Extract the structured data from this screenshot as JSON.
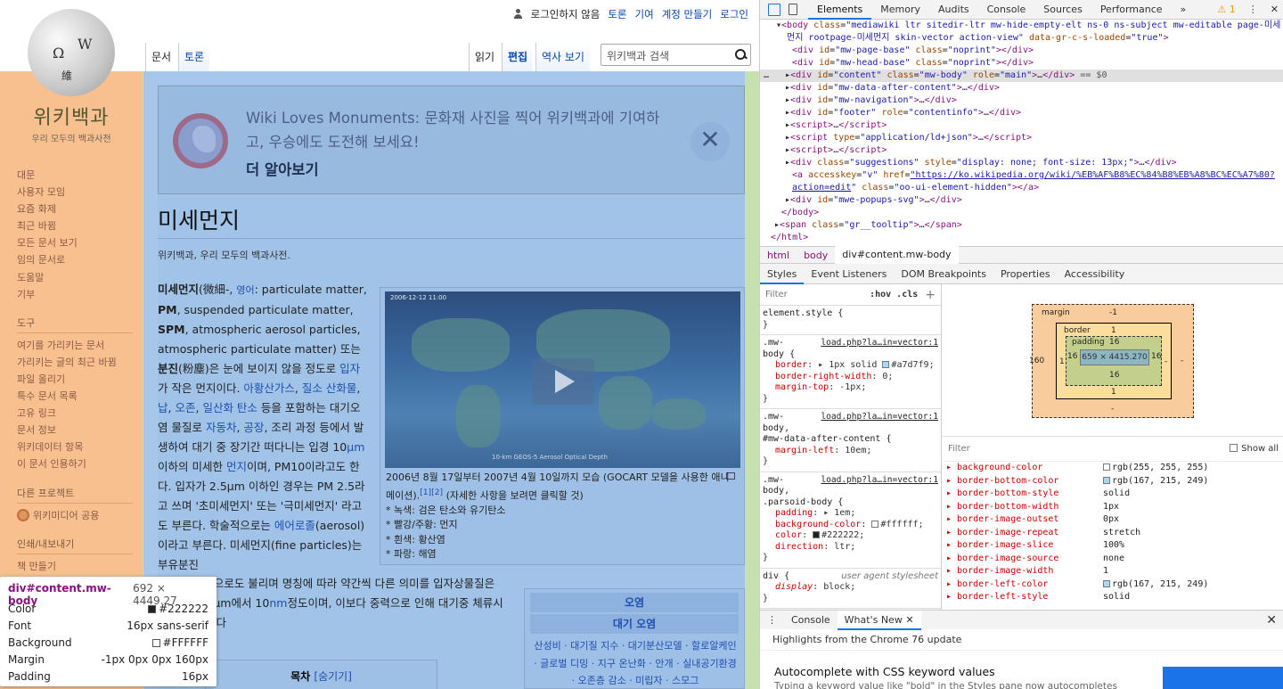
{
  "wiki": {
    "logo": {
      "title": "위키백과",
      "subtitle": "우리 모두의 백과사전",
      "glyphs": [
        "Ω",
        "W",
        "維"
      ]
    },
    "personal": {
      "not_logged_in": "로그인하지 않음",
      "talk": "토론",
      "contributions": "기여",
      "create_account": "계정 만들기",
      "login": "로그인"
    },
    "tabs": {
      "article": "문서",
      "talk": "토론",
      "read": "읽기",
      "edit": "편집",
      "history": "역사 보기"
    },
    "search": {
      "placeholder": "위키백과 검색"
    },
    "nav": {
      "main": [
        "대문",
        "사용자 모임",
        "요즘 화제",
        "최근 바뀜",
        "모든 문서 보기",
        "임의 문서로",
        "도움말",
        "기부"
      ],
      "tools_heading": "도구",
      "tools": [
        "여기를 가리키는 문서",
        "가리키는 글의 최근 바뀜",
        "파일 올리기",
        "특수 문서 목록",
        "고유 링크",
        "문서 정보",
        "위키데이터 항목",
        "이 문서 인용하기"
      ],
      "projects_heading": "다른 프로젝트",
      "projects": [
        "위키미디어 공용"
      ],
      "print_heading": "인쇄/내보내기",
      "print": [
        "책 만들기"
      ]
    },
    "banner": {
      "text": "Wiki Loves Monuments: 문화재 사진을 찍어 위키백과에 기여하고, 우승에도 도전해 보세요!",
      "more": "더 알아보기",
      "close": "✕"
    },
    "title": "미세먼지",
    "tagline": "위키백과, 우리 모두의 백과사전.",
    "thumb": {
      "timestamp": "2006-12-12 11:00",
      "video_caption": "10-km GEOS-5 Aerosol Optical Depth",
      "caption": "2006년 8월 17일부터 2007년 4월 10일까지 모습 (GOCART 모델을 사용한 애니메이션).",
      "ref": "[1][2]",
      "caption2": " (자세한 사항을 보려면 클릭할 것)",
      "items": [
        "* 녹색: 검은 탄소와 유기탄소",
        "* 빨강/주황: 먼지",
        "* 흰색: 황산염",
        "* 파랑: 해염"
      ]
    },
    "infobox": {
      "h1": "오염",
      "h2": "대기 오염",
      "links": "산성비 · 대기질 지수 · 대기분산모델 · 할로알케인 · 글로벌 디밍 · 지구 온난화 · 안개 · 실내공기환경 · 오존층 감소 · 미립자 · 스모그"
    },
    "toc": {
      "title": "목차",
      "toggle": "[숨기기]"
    }
  },
  "tooltip": {
    "selector": "div#content.mw-body",
    "size": "692 × 4449.27",
    "rows": [
      {
        "k": "Color",
        "v": "#222222",
        "swatch": "#222222"
      },
      {
        "k": "Font",
        "v": "16px sans-serif"
      },
      {
        "k": "Background",
        "v": "#FFFFFF",
        "swatch": "#FFFFFF"
      },
      {
        "k": "Margin",
        "v": "-1px 0px 0px 160px"
      },
      {
        "k": "Padding",
        "v": "16px"
      }
    ]
  },
  "devtools": {
    "tabs": [
      "Elements",
      "Memory",
      "Audits",
      "Console",
      "Sources",
      "Performance"
    ],
    "more": "»",
    "warning_count": "1",
    "breadcrumbs": [
      "html",
      "body",
      "div#content.mw-body"
    ],
    "subtabs": [
      "Styles",
      "Event Listeners",
      "DOM Breakpoints",
      "Properties",
      "Accessibility"
    ],
    "styles_filter": "Filter",
    "hov": ":hov  .cls",
    "plus": "+",
    "box_model": {
      "margin_label": "margin",
      "margin_top": "-1",
      "margin_left": "160",
      "margin_right": "-",
      "margin_bottom": "-",
      "border_label": "border",
      "border": "1",
      "border_right": "-",
      "padding_label": "padding",
      "padding": "16",
      "content": "659 × 4415.270"
    },
    "computed_filter": "Filter",
    "show_all": "Show all",
    "computed": [
      {
        "n": "background-color",
        "v": "rgb(255, 255, 255)",
        "swatch": "#ffffff"
      },
      {
        "n": "border-bottom-color",
        "v": "rgb(167, 215, 249)",
        "swatch": "#a7d7f9"
      },
      {
        "n": "border-bottom-style",
        "v": "solid"
      },
      {
        "n": "border-bottom-width",
        "v": "1px"
      },
      {
        "n": "border-image-outset",
        "v": "0px"
      },
      {
        "n": "border-image-repeat",
        "v": "stretch"
      },
      {
        "n": "border-image-slice",
        "v": "100%"
      },
      {
        "n": "border-image-source",
        "v": "none"
      },
      {
        "n": "border-image-width",
        "v": "1"
      },
      {
        "n": "border-left-color",
        "v": "rgb(167, 215, 249)",
        "swatch": "#a7d7f9"
      },
      {
        "n": "border-left-style",
        "v": "solid"
      }
    ],
    "drawer": {
      "console": "Console",
      "whats_new": "What's New",
      "highlights": "Highlights from the Chrome 76 update",
      "headline": "Autocomplete with CSS keyword values",
      "desc": "Typing a keyword value like \"bold\" in the Styles pane now autocompletes"
    }
  }
}
